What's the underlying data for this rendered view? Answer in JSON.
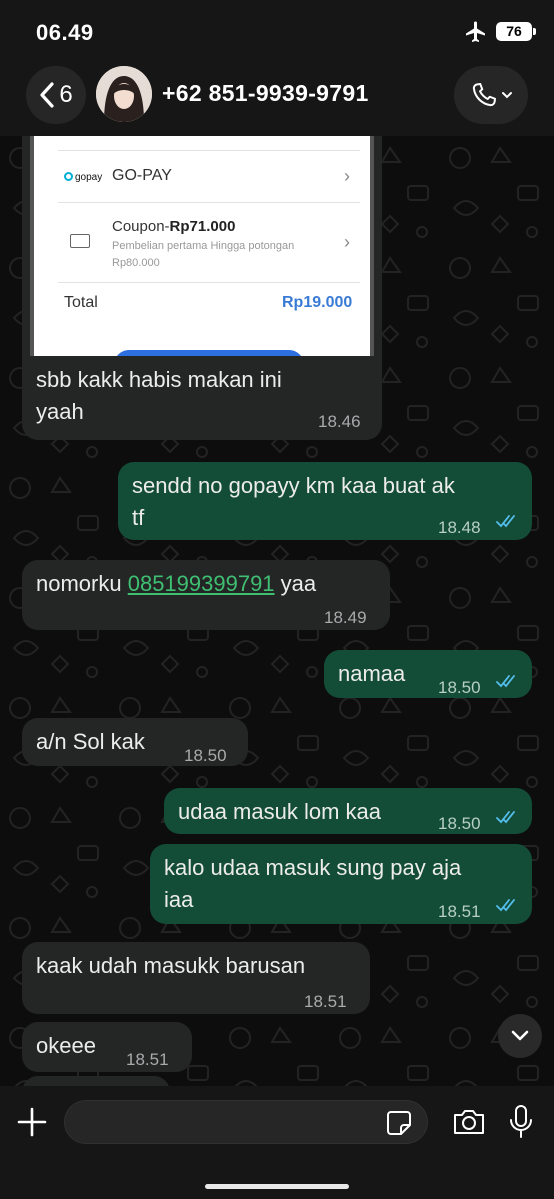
{
  "status_bar": {
    "time": "06.49",
    "battery": "76"
  },
  "header": {
    "back_count": "6",
    "contact": "+62 851-9939-9791"
  },
  "image_message": {
    "payment_method": "GO-PAY",
    "gopay_logo": "gopay",
    "coupon_prefix": "Coupon-",
    "coupon_amount": "Rp71.000",
    "coupon_desc": "Pembelian pertama Hingga potongan Rp80.000",
    "total_label": "Total",
    "total_value": "Rp19.000",
    "caption_line1": "sbb kakk habis makan ini",
    "caption_line2": "yaah",
    "time": "18.46"
  },
  "messages": [
    {
      "dir": "out",
      "line1": "sendd no gopayy km kaa buat ak",
      "line2": "tf",
      "time": "18.48",
      "read": true
    },
    {
      "dir": "in",
      "prefix": "nomorku ",
      "phone": "085199399791",
      "suffix": " yaa",
      "time": "18.49"
    },
    {
      "dir": "out",
      "line1": "namaa",
      "time": "18.50",
      "read": true
    },
    {
      "dir": "in",
      "line1": "a/n Sol kak",
      "time": "18.50"
    },
    {
      "dir": "out",
      "line1": "udaa masuk lom kaa",
      "time": "18.50",
      "read": true
    },
    {
      "dir": "out",
      "line1": "kalo udaa masuk sung pay aja",
      "line2": "iaa",
      "time": "18.51",
      "read": true
    },
    {
      "dir": "in",
      "line1": "kaak udah masukk barusan",
      "time": "18.51"
    },
    {
      "dir": "in",
      "line1": "okeee",
      "time": "18.51"
    }
  ],
  "input": {
    "placeholder": ""
  },
  "colors": {
    "incoming": "#242626",
    "outgoing": "#144d37",
    "link": "#3fbf72",
    "read_ticks": "#53bdeb"
  },
  "icons": [
    "airplane-icon",
    "chevron-left-icon",
    "phone-icon",
    "chevron-down-icon",
    "plus-icon",
    "sticker-icon",
    "camera-icon",
    "mic-icon",
    "double-check-icon"
  ]
}
